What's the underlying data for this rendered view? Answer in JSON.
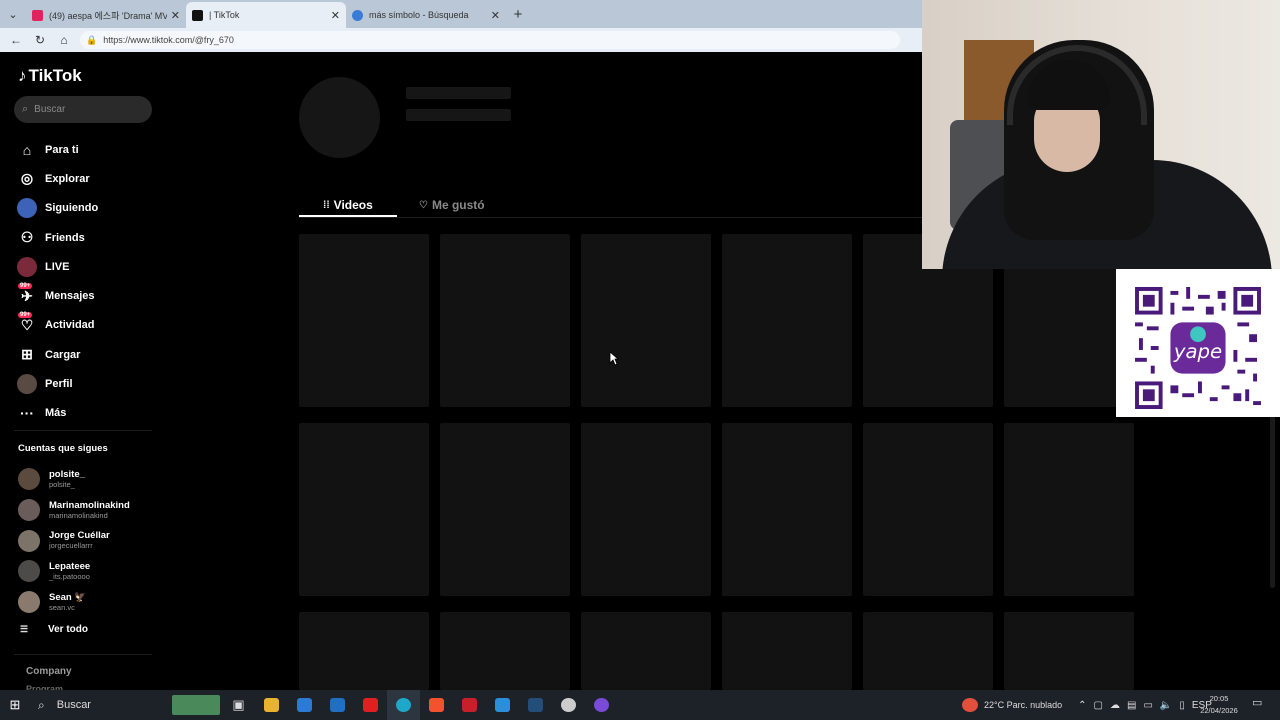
{
  "browser": {
    "tabs": [
      {
        "title": "(49) aespa 에스파 'Drama' MV - Y",
        "favicon_color": "#e0245e",
        "active": false
      },
      {
        "title": "| TikTok",
        "favicon_color": "#111111",
        "active": true
      },
      {
        "title": "más símbolo - Búsqueda",
        "favicon_color": "#3a7bd5",
        "active": false
      }
    ],
    "new_tab_glyph": "+",
    "url": "https://www.tiktok.com/@fry_670"
  },
  "tiktok": {
    "logo_text": "TikTok",
    "search_placeholder": "Buscar",
    "nav": [
      {
        "label": "Para ti",
        "icon": "home-icon"
      },
      {
        "label": "Explorar",
        "icon": "compass-icon"
      },
      {
        "label": "Siguiendo",
        "icon": "following-avatar"
      },
      {
        "label": "Friends",
        "icon": "friends-icon"
      },
      {
        "label": "LIVE",
        "icon": "live-avatar"
      },
      {
        "label": "Mensajes",
        "icon": "messages-icon",
        "badge": "99+"
      },
      {
        "label": "Actividad",
        "icon": "activity-icon",
        "badge": "99+"
      },
      {
        "label": "Cargar",
        "icon": "upload-icon"
      },
      {
        "label": "Perfil",
        "icon": "profile-avatar"
      },
      {
        "label": "Más",
        "icon": "more-icon"
      }
    ],
    "following_heading": "Cuentas que sigues",
    "following": [
      {
        "name": "polsite_",
        "handle": "polsite_"
      },
      {
        "name": "Marinamolinakind",
        "handle": "marinamolinakind"
      },
      {
        "name": "Jorge Cuéllar",
        "handle": "jorgecuellarrr"
      },
      {
        "name": "Lepateee",
        "handle": "_its.patoooo"
      },
      {
        "name": "Sean 🦅",
        "handle": "sean.vc"
      }
    ],
    "see_all": "Ver todo",
    "footer_company": "Company",
    "footer_program": "Program",
    "profile_tabs": [
      {
        "label": "Videos",
        "active": true
      },
      {
        "label": "Me gustó",
        "active": false
      }
    ]
  },
  "taskbar": {
    "search_label": "Buscar",
    "weather": "22°C  Parc. nublado",
    "language": "ESP",
    "time": "20:05",
    "date": "22/04/2026"
  }
}
